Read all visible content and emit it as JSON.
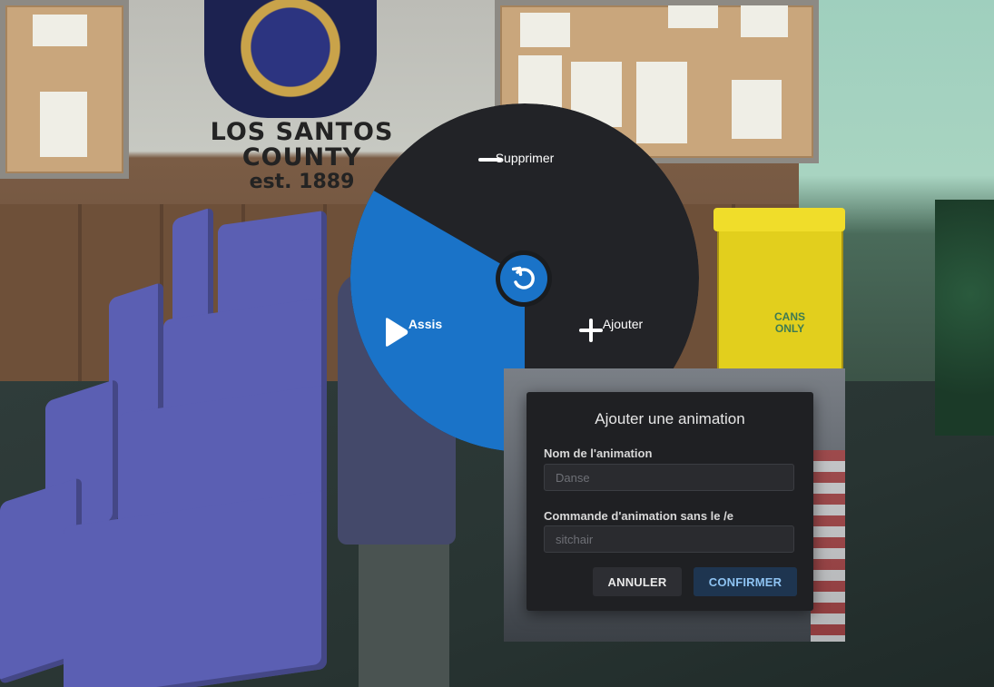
{
  "scene": {
    "sign_line1": "LOS SANTOS COUNTY",
    "sign_line2": "est. 1889",
    "bin_label": "CANS ONLY"
  },
  "radial_menu": {
    "remove": {
      "label": "Supprimer",
      "icon": "minus-icon"
    },
    "sit": {
      "label": "Assis",
      "icon": "play-icon",
      "selected": true
    },
    "add": {
      "label": "Ajouter",
      "icon": "plus-icon"
    },
    "center": {
      "icon": "undo-icon"
    },
    "colors": {
      "wheel": "#222327",
      "selected": "#1a73c8",
      "text": "#ffffff"
    }
  },
  "dialog": {
    "title": "Ajouter une animation",
    "name_label": "Nom de l'animation",
    "name_placeholder": "Danse",
    "name_value": "",
    "command_label": "Commande d'animation sans le /e",
    "command_placeholder": "sitchair",
    "command_value": "",
    "cancel_label": "ANNULER",
    "confirm_label": "CONFIRMER",
    "colors": {
      "background": "#1f2023",
      "confirm_text": "#8ec3f2",
      "confirm_bg": "#1e3550"
    }
  }
}
